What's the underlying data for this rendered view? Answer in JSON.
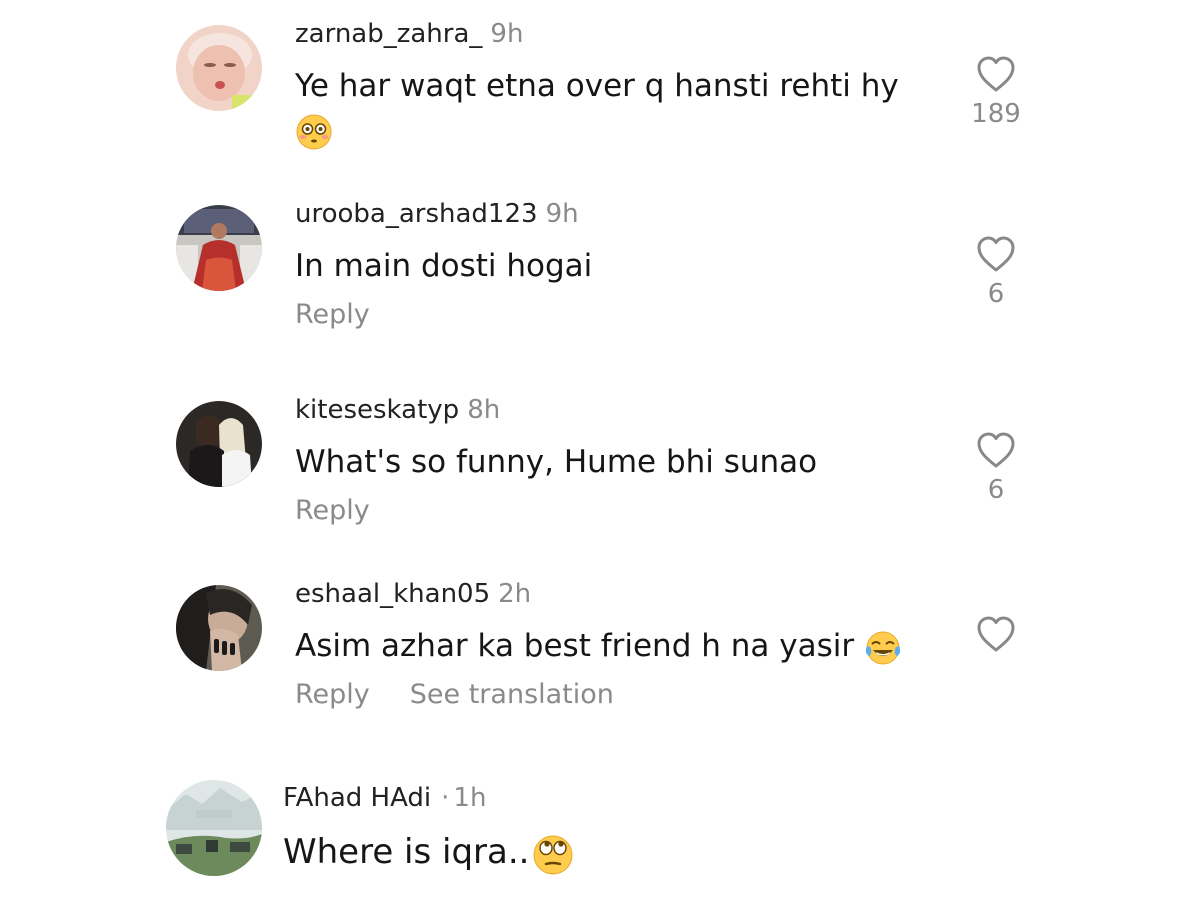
{
  "comments": [
    {
      "username": "zarnab_zahra_",
      "time": "9h",
      "text": "Ye har waqt etna over q hansti rehti hy",
      "emoji": "flushed-face-emoji",
      "likes": "189"
    },
    {
      "username": "urooba_arshad123",
      "time": "9h",
      "text": "In main dosti hogai",
      "reply_label": "Reply",
      "likes": "6"
    },
    {
      "username": "kiteseskatyp",
      "time": "8h",
      "text": "What's so funny, Hume bhi sunao",
      "reply_label": "Reply",
      "likes": "6"
    },
    {
      "username": "eshaal_khan05",
      "time": "2h",
      "text": "Asim azhar ka best friend h na yasir",
      "emoji": "tears-of-joy-emoji",
      "reply_label": "Reply",
      "see_translation_label": "See translation"
    },
    {
      "username": "FAhad HAdi",
      "separator": "·",
      "time": "1h",
      "text": "Where is iqra..",
      "emoji": "eye-roll-emoji"
    }
  ],
  "icons": {
    "like": "heart-outline-icon"
  },
  "colors": {
    "username": "#222222",
    "secondary": "#8a8a8a",
    "text": "#161616"
  }
}
